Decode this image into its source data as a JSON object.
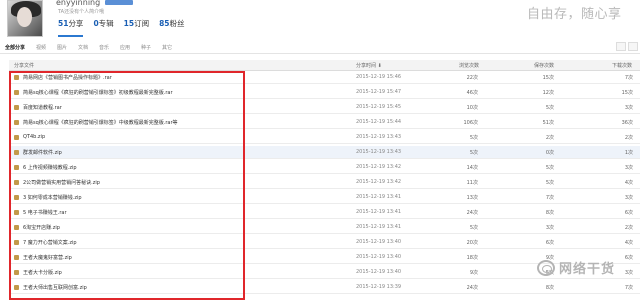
{
  "profile": {
    "username": "enyyinning",
    "badge": "",
    "bio": "TA还没有个人简介哦",
    "stats": [
      {
        "count": "51",
        "label": "分享"
      },
      {
        "count": "0",
        "label": "专辑"
      },
      {
        "count": "15",
        "label": "订阅"
      },
      {
        "count": "85",
        "label": "粉丝"
      }
    ],
    "share_button": "",
    "slogan": "自由存，随心享"
  },
  "tabs": [
    "全部分享",
    "视频",
    "图片",
    "文档",
    "音乐",
    "应用",
    "种子",
    "其它"
  ],
  "table": {
    "headers": {
      "file": "分享文件",
      "time": "分享时间 ⬇",
      "views": "浏览次数",
      "saves": "保存次数",
      "downloads": "下载次数"
    },
    "rows": [
      {
        "name": "简易网店《营销图书产品操作标题》.rar",
        "time": "2015-12-19 15:46",
        "views": "22次",
        "saves": "15次",
        "downloads": "7次"
      },
      {
        "name": "简易sq核心课程《疯狂的刷营销引爆标签》初级教程最新完整版.rar",
        "time": "2015-12-19 15:47",
        "views": "46次",
        "saves": "12次",
        "downloads": "15次"
      },
      {
        "name": "百度知道教程.rar",
        "time": "2015-12-19 15:45",
        "views": "10次",
        "saves": "5次",
        "downloads": "3次"
      },
      {
        "name": "简易sq核心课程《疯狂的刷营销引爆标签》中级教程最新完整版.rar等",
        "time": "2015-12-19 15:44",
        "views": "106次",
        "saves": "51次",
        "downloads": "36次"
      },
      {
        "name": "QT4b.zip",
        "time": "2015-12-19 13:43",
        "views": "5次",
        "saves": "2次",
        "downloads": "2次"
      },
      {
        "name": "群发邮件软件.zip",
        "time": "2015-12-19 13:43",
        "views": "5次",
        "saves": "0次",
        "downloads": "1次"
      },
      {
        "name": "6 上传视频赚钱教程.zip",
        "time": "2015-12-19 13:42",
        "views": "14次",
        "saves": "5次",
        "downloads": "3次"
      },
      {
        "name": "2公司做营销实用营销问答秘诀.zip",
        "time": "2015-12-19 13:42",
        "views": "11次",
        "saves": "5次",
        "downloads": "4次"
      },
      {
        "name": "3 如何零成本营销赚钱.zip",
        "time": "2015-12-19 13:41",
        "views": "13次",
        "saves": "7次",
        "downloads": "3次"
      },
      {
        "name": "5 电子书赚钱王.rar",
        "time": "2015-12-19 13:41",
        "views": "24次",
        "saves": "8次",
        "downloads": "6次"
      },
      {
        "name": "6淘宝开店赚.zip",
        "time": "2015-12-19 13:41",
        "views": "5次",
        "saves": "3次",
        "downloads": "2次"
      },
      {
        "name": "7 魔力开心营销文案.zip",
        "time": "2015-12-19 13:40",
        "views": "20次",
        "saves": "6次",
        "downloads": "4次"
      },
      {
        "name": "王者大魔鬼好富营.zip",
        "time": "2015-12-19 13:40",
        "views": "18次",
        "saves": "9次",
        "downloads": "6次"
      },
      {
        "name": "王者大卡分版.zip",
        "time": "2015-12-19 13:40",
        "views": "9次",
        "saves": "5次",
        "downloads": "3次"
      },
      {
        "name": "王者大师出售互联网创富.zip",
        "time": "2015-12-19 13:39",
        "views": "24次",
        "saves": "8次",
        "downloads": "7次"
      }
    ]
  },
  "watermark": "网络干货",
  "colors": {
    "accent": "#2b78d0",
    "highlight_box": "#e0262b"
  }
}
